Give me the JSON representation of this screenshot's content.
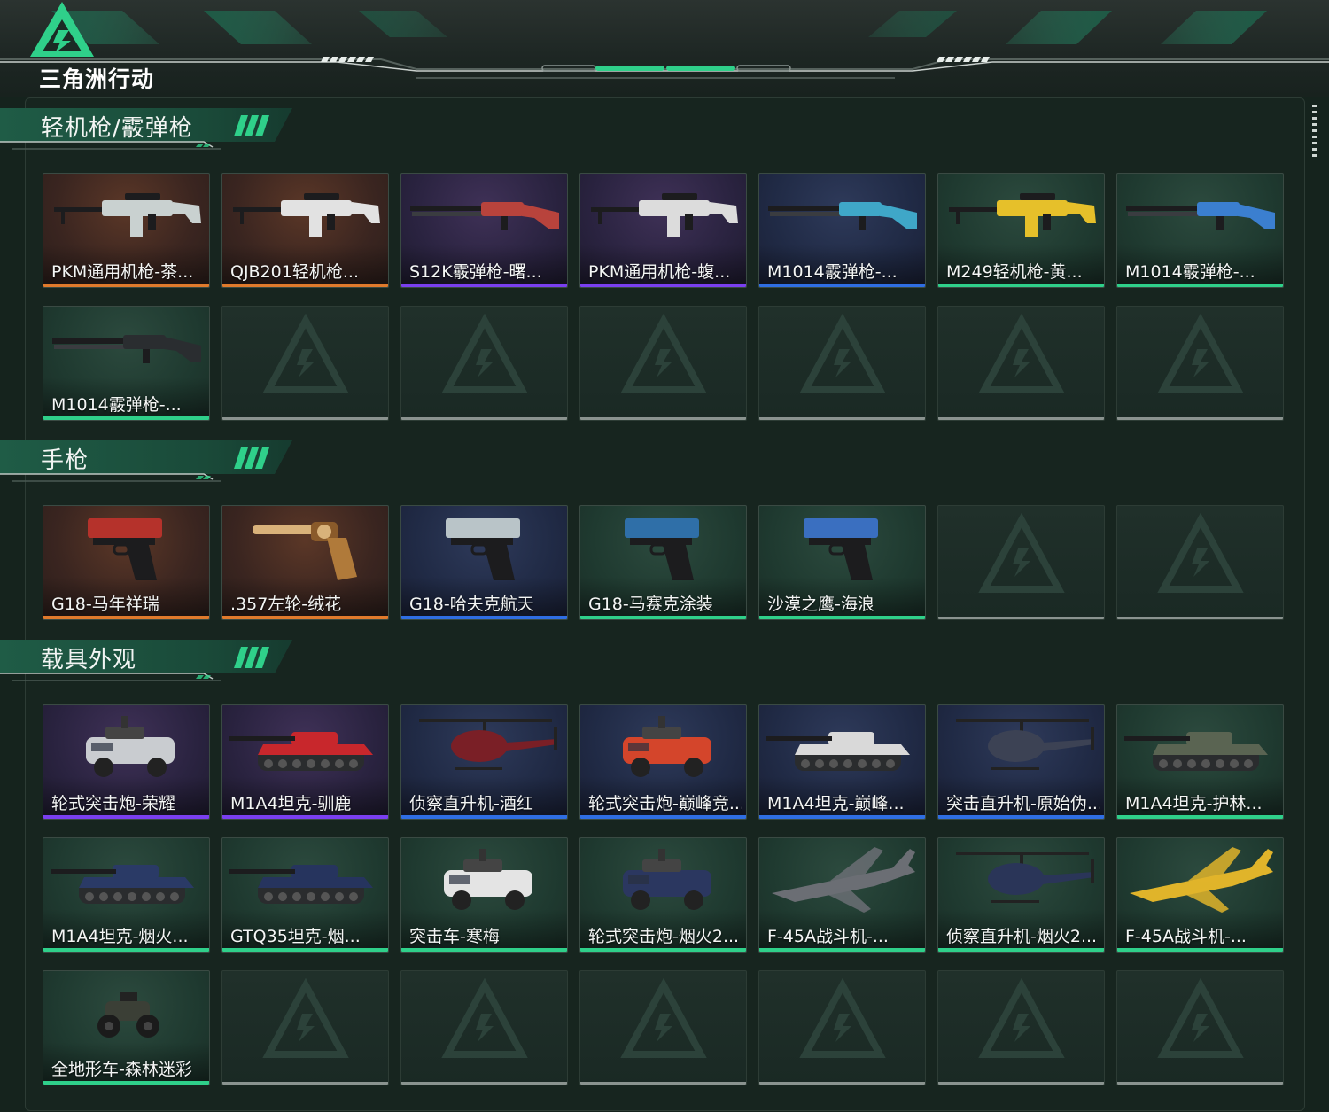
{
  "header": {
    "game_name": "三角洲行动"
  },
  "colors": {
    "orange": "#e07a2c",
    "purple": "#7a3ff0",
    "blue": "#2f6ee3",
    "green": "#2fd08a",
    "accent": "#2fd08a"
  },
  "sections": [
    {
      "title": "轻机枪/霰弹枪",
      "items": [
        {
          "name": "PKM通用机枪-茶...",
          "rarity": "orange",
          "icon": "machine-gun-icon",
          "tint": "#c9d1d0"
        },
        {
          "name": "QJB201轻机枪...",
          "rarity": "orange",
          "icon": "machine-gun-icon",
          "tint": "#e2e2e2"
        },
        {
          "name": "S12K霰弹枪-曙...",
          "rarity": "purple",
          "icon": "shotgun-icon",
          "tint": "#b8433c"
        },
        {
          "name": "PKM通用机枪-蝮...",
          "rarity": "purple",
          "icon": "machine-gun-icon",
          "tint": "#dcdcdc"
        },
        {
          "name": "M1014霰弹枪-...",
          "rarity": "blue",
          "icon": "shotgun-icon",
          "tint": "#3fa7c8"
        },
        {
          "name": "M249轻机枪-黄...",
          "rarity": "green",
          "icon": "machine-gun-icon",
          "tint": "#e6c02a"
        },
        {
          "name": "M1014霰弹枪-...",
          "rarity": "green",
          "icon": "shotgun-icon",
          "tint": "#3b7fd0"
        },
        {
          "name": "M1014霰弹枪-...",
          "rarity": "green",
          "icon": "shotgun-icon",
          "tint": "#2a2d30"
        }
      ],
      "empty_slots": 6
    },
    {
      "title": "手枪",
      "items": [
        {
          "name": "G18-马年祥瑞",
          "rarity": "orange",
          "icon": "pistol-icon",
          "tint": "#b5322b"
        },
        {
          "name": ".357左轮-绒花",
          "rarity": "orange",
          "icon": "revolver-icon",
          "tint": "#d9b27a"
        },
        {
          "name": "G18-哈夫克航天",
          "rarity": "blue",
          "icon": "pistol-icon",
          "tint": "#b9c4c8"
        },
        {
          "name": "G18-马赛克涂装",
          "rarity": "green",
          "icon": "pistol-icon",
          "tint": "#2f6fa8"
        },
        {
          "name": "沙漠之鹰-海浪",
          "rarity": "green",
          "icon": "pistol-icon",
          "tint": "#3a6fc0"
        }
      ],
      "empty_slots": 2
    },
    {
      "title": "载具外观",
      "items": [
        {
          "name": "轮式突击炮-荣耀",
          "rarity": "purple",
          "icon": "armored-car-icon",
          "tint": "#c9ccd0"
        },
        {
          "name": "M1A4坦克-驯鹿",
          "rarity": "purple",
          "icon": "tank-icon",
          "tint": "#c8272c"
        },
        {
          "name": "侦察直升机-酒红",
          "rarity": "blue",
          "icon": "helicopter-icon",
          "tint": "#7a1f26"
        },
        {
          "name": "轮式突击炮-巅峰竞...",
          "rarity": "blue",
          "icon": "armored-car-icon",
          "tint": "#d4452b"
        },
        {
          "name": "M1A4坦克-巅峰...",
          "rarity": "blue",
          "icon": "tank-icon",
          "tint": "#d9d9d9"
        },
        {
          "name": "突击直升机-原始伪...",
          "rarity": "blue",
          "icon": "helicopter-icon",
          "tint": "#3c4254"
        },
        {
          "name": "M1A4坦克-护林...",
          "rarity": "green",
          "icon": "tank-icon",
          "tint": "#5a6452"
        },
        {
          "name": "M1A4坦克-烟火...",
          "rarity": "green",
          "icon": "tank-icon",
          "tint": "#2a3a66"
        },
        {
          "name": "GTQ35坦克-烟...",
          "rarity": "green",
          "icon": "tank-icon",
          "tint": "#26345e"
        },
        {
          "name": "突击车-寒梅",
          "rarity": "green",
          "icon": "armored-car-icon",
          "tint": "#e4e4e4"
        },
        {
          "name": "轮式突击炮-烟火2...",
          "rarity": "green",
          "icon": "armored-car-icon",
          "tint": "#2b3760"
        },
        {
          "name": "F-45A战斗机-...",
          "rarity": "green",
          "icon": "jet-icon",
          "tint": "#6b6e74"
        },
        {
          "name": "侦察直升机-烟火2...",
          "rarity": "green",
          "icon": "helicopter-icon",
          "tint": "#2a3558"
        },
        {
          "name": "F-45A战斗机-...",
          "rarity": "green",
          "icon": "jet-icon",
          "tint": "#e0b42a"
        },
        {
          "name": "全地形车-森林迷彩",
          "rarity": "green",
          "icon": "atv-icon",
          "tint": "#3b3f36"
        }
      ],
      "empty_slots": 6
    }
  ]
}
